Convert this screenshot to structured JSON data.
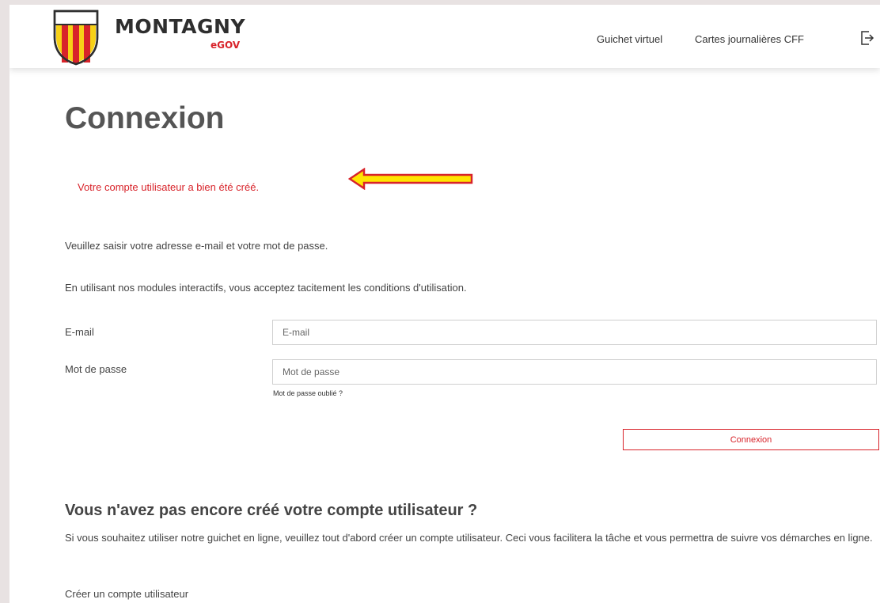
{
  "header": {
    "brand_name": "MONTAGNY",
    "brand_sub": "eGOV",
    "nav": [
      "Guichet virtuel",
      "Cartes journalières CFF"
    ],
    "logout_icon": "logout-icon",
    "colors": {
      "brand_red": "#d8232a",
      "logo_yellow": "#f7d117"
    }
  },
  "main": {
    "title": "Connexion",
    "success_message": "Votre compte utilisateur a bien été créé.",
    "annotation_arrow": {
      "color": "#ffe500",
      "outline": "#d8232a"
    },
    "intro_1": "Veuillez saisir votre adresse e-mail et votre mot de passe.",
    "intro_2": "En utilisant nos modules interactifs, vous acceptez tacitement les conditions d'utilisation."
  },
  "form": {
    "email_label": "E-mail",
    "email_placeholder": "E-mail",
    "password_label": "Mot de passe",
    "password_placeholder": "Mot de passe",
    "forgot_link": "Mot de passe oublié ?",
    "submit_label": "Connexion"
  },
  "signup": {
    "title": "Vous n'avez pas encore créé votre compte utilisateur ?",
    "text": "Si vous souhaitez utiliser notre guichet en ligne, veuillez tout d'abord créer un compte utilisateur. Ceci vous facilitera la tâche et vous permettra de suivre vos démarches en ligne.",
    "link": "Créer un compte utilisateur"
  }
}
